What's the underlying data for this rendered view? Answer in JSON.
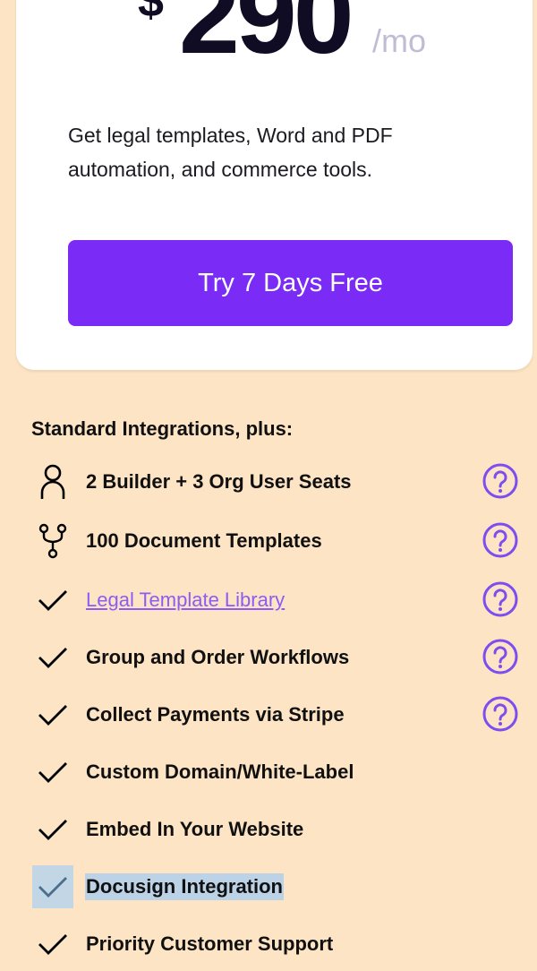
{
  "pricing_card": {
    "currency": "$",
    "price": "290",
    "period": "/mo",
    "description": "Get legal templates, Word and PDF automation, and commerce tools.",
    "cta_label": "Try 7 Days Free"
  },
  "features_section": {
    "heading": "Standard Integrations, plus:",
    "items": [
      {
        "label": "2 Builder + 3 Org User Seats",
        "icon": "user-icon",
        "has_help": true,
        "is_link": false
      },
      {
        "label": "100 Document Templates",
        "icon": "workflow-branch-icon",
        "has_help": true,
        "is_link": false
      },
      {
        "label": "Legal Template Library",
        "icon": "check-icon",
        "has_help": true,
        "is_link": true
      },
      {
        "label": "Group and Order Workflows",
        "icon": "check-icon",
        "has_help": true,
        "is_link": false
      },
      {
        "label": "Collect Payments via Stripe",
        "icon": "check-icon",
        "has_help": true,
        "is_link": false
      },
      {
        "label": "Custom Domain/White-Label",
        "icon": "check-icon",
        "has_help": false,
        "is_link": false
      },
      {
        "label": "Embed In Your Website",
        "icon": "check-icon",
        "has_help": false,
        "is_link": false
      },
      {
        "label": "Docusign Integration",
        "icon": "check-icon",
        "has_help": false,
        "is_link": false,
        "selected": true
      },
      {
        "label": "Priority Customer Support",
        "icon": "check-icon",
        "has_help": false,
        "is_link": false
      }
    ]
  },
  "colors": {
    "page_background": "#fde4c4",
    "card_background": "#ffffff",
    "accent_purple": "#7a2bf5",
    "help_icon_purple": "#7c4ef0",
    "link_purple": "#8b5cf6",
    "period_gray": "#bfbdd4",
    "selection_blue": "#bcd2e6"
  }
}
